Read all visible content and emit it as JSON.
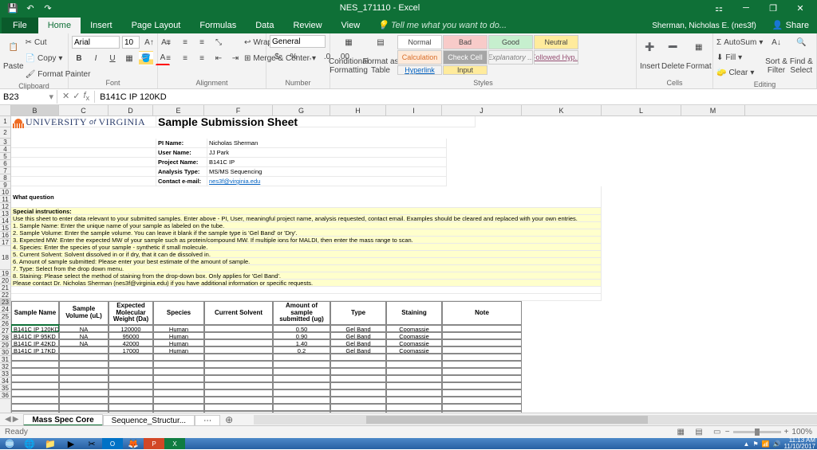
{
  "title": "NES_171110 - Excel",
  "account": "Sherman, Nicholas E. (nes3f)",
  "share_label": "Share",
  "tabs": [
    "File",
    "Home",
    "Insert",
    "Page Layout",
    "Formulas",
    "Data",
    "Review",
    "View"
  ],
  "tell_me": "Tell me what you want to do...",
  "ribbon": {
    "clipboard": {
      "paste": "Paste",
      "cut": "Cut",
      "copy": "Copy",
      "fp": "Format Painter",
      "label": "Clipboard"
    },
    "font": {
      "name": "Arial",
      "size": "10",
      "label": "Font"
    },
    "align": {
      "wrap": "Wrap Text",
      "merge": "Merge & Center",
      "label": "Alignment"
    },
    "number": {
      "format": "General",
      "label": "Number"
    },
    "styles": {
      "cf": "Conditional\nFormatting",
      "fat": "Format as\nTable",
      "label": "Styles",
      "gallery": [
        "Normal",
        "Bad",
        "Good",
        "Neutral",
        "Calculation",
        "Check Cell",
        "Explanatory ...",
        "Followed Hyp...",
        "Hyperlink",
        "Input"
      ]
    },
    "cells": {
      "insert": "Insert",
      "delete": "Delete",
      "format": "Format",
      "label": "Cells"
    },
    "editing": {
      "sum": "AutoSum",
      "fill": "Fill",
      "clear": "Clear",
      "sort": "Sort &\nFilter",
      "find": "Find &\nSelect",
      "label": "Editing"
    }
  },
  "formulabar": {
    "namebox": "B23",
    "value": "B141C IP 120KD"
  },
  "columns": [
    "B",
    "C",
    "D",
    "E",
    "F",
    "G",
    "H",
    "I",
    "J",
    "K",
    "L",
    "M"
  ],
  "worksheet": {
    "title": "Sample Submission Sheet",
    "logo": "University of Virginia",
    "fields": [
      [
        "PI Name:",
        "Nicholas Sherman"
      ],
      [
        "User Name:",
        "JJ Park"
      ],
      [
        "Project Name:",
        "B141C IP"
      ],
      [
        "Analysis Type:",
        "MS/MS Sequencing"
      ],
      [
        "Contact e-mail:",
        "nes3f@virginia.edu"
      ]
    ],
    "question": "What question\nwill the expected\ndata answer?",
    "instr_hdr": "Special instructions:",
    "instructions": [
      "Use this sheet to enter data relevant to your submitted samples. Enter above - PI, User, meaningful project name, analysis requested, contact email. Examples should be cleared and replaced with your own entries.",
      "1. Sample Name:  Enter the unique name of your sample as labeled on the tube.",
      "2. Sample Volume:  Enter the sample volume. You can leave it blank if the sample type is 'Gel Band' or 'Dry'.",
      "3. Expected MW:  Enter the expected MW of your sample such as protein/compound MW. If multiple ions for MALDI, then enter the mass range to scan.",
      "4. Species:  Enter the species of your sample - synthetic if small molecule.",
      "5. Current Solvent:  Solvent dissolved in or if dry, that it can de dissolved in.",
      "6. Amount of sample submitted:  Please enter your best estimate of the amount of sample.",
      "7. Type: Select from the drop down menu.",
      "8. Staining:  Please select the method of staining from the drop-down box. Only applies for 'Gel Band'.",
      "Please contact Dr. Nicholas Sherman (nes3f@virginia.edu) if you have additional information or specific requests."
    ],
    "headers": [
      "Sample Name",
      "Sample Volume (uL)",
      "Expected Molecular Weight (Da)",
      "Species",
      "Current Solvent",
      "Amount of sample submitted (ug)",
      "Type",
      "Staining",
      "Note"
    ],
    "rows": [
      [
        "B141C IP 120KD",
        "NA",
        "120000",
        "Human",
        "",
        "0.50",
        "Gel Band",
        "Coomassie",
        ""
      ],
      [
        "B141C IP 95KD",
        "NA",
        "95000",
        "Human",
        "",
        "0.90",
        "Gel Band",
        "Coomassie",
        ""
      ],
      [
        "B141C IP 42KD",
        "NA",
        "42000",
        "Human",
        "",
        "1.40",
        "Gel Band",
        "Coomassie",
        ""
      ],
      [
        "B141C IP 17KD",
        "",
        "17000",
        "Human",
        "",
        "0.2",
        "Gel Band",
        "Coomassie",
        ""
      ]
    ]
  },
  "sheet_tabs": [
    "Mass Spec Core",
    "Sequence_Structur..."
  ],
  "statusbar": {
    "ready": "Ready",
    "zoom": "100%"
  },
  "taskbar": {
    "time": "11:13 AM",
    "date": "11/10/2017"
  }
}
